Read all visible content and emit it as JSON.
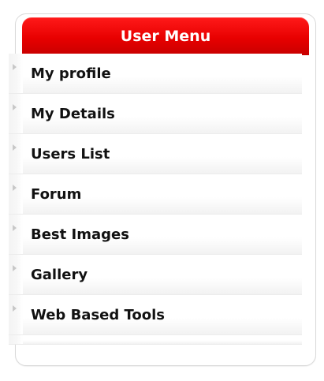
{
  "menu": {
    "title": "User Menu",
    "items": [
      {
        "label": "My profile"
      },
      {
        "label": "My Details"
      },
      {
        "label": "Users List"
      },
      {
        "label": "Forum"
      },
      {
        "label": "Best Images"
      },
      {
        "label": "Gallery"
      },
      {
        "label": "Web Based Tools"
      }
    ]
  },
  "colors": {
    "header": "#e80000",
    "header_text": "#ffffff",
    "item_text": "#111111",
    "arrow": "#c8c8c8"
  },
  "icons": {
    "item_marker": "chevron-right-icon"
  }
}
